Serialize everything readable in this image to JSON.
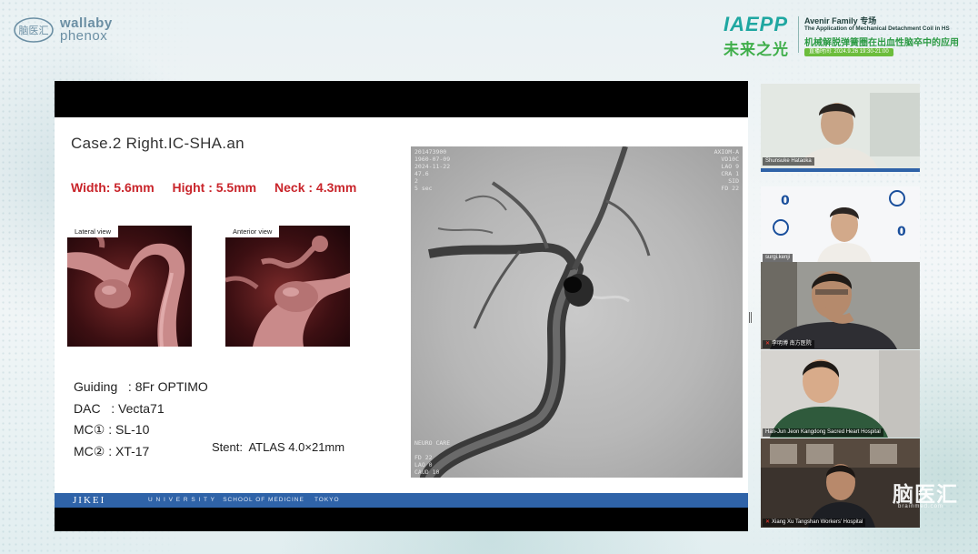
{
  "logos": {
    "brainmed": "脑医汇",
    "wallaby_line1": "wallaby",
    "wallaby_line2": "phenox"
  },
  "event": {
    "brand": "IAEPP",
    "brand_cn": "未来之光",
    "session": "Avenir Family 专场",
    "subtitle_en": "The Application of Mechanical Detachment Coil in HS",
    "subtitle_cn": "机械解脱弹簧圈在出血性脑卒中的应用",
    "date_line": "直播时间: 2024.9.26 19:30-21:00"
  },
  "slide": {
    "title": "Case.2  Right.IC-SHA.an",
    "width": "Width: 5.6mm",
    "height": "Hight : 5.5mm",
    "neck": "Neck  : 4.3mm",
    "lateral_label": "Lateral view",
    "anterior_label": "Anterior view",
    "specs": [
      "Guiding   : 8Fr OPTIMO",
      "DAC   : Vecta71",
      "MC① : SL-10",
      "MC② : XT-17"
    ],
    "stent": "Stent:  ATLAS 4.0×21mm",
    "footer_left": "JIKEI",
    "footer_right": "U N I V E R S I T Y   SCHOOL OF MEDICINE    TOKYO"
  },
  "participants": [
    {
      "name": "Shunsuke Hataoka"
    },
    {
      "name": "surgi.kenji"
    },
    {
      "name": "李明博 南方医院"
    },
    {
      "name": "Han-Jun Jeon Kangdong Sacred Heart Hospital"
    },
    {
      "name": "Xiang Xu Tangshan Workers' Hospital"
    }
  ],
  "watermark": {
    "text": "脑医汇",
    "url": "brainmed.com"
  },
  "colors": {
    "accent_red": "#c9252b",
    "footer_blue": "#2f63a8",
    "brand_teal": "#1fa7a1",
    "brand_green": "#3fae4a"
  }
}
